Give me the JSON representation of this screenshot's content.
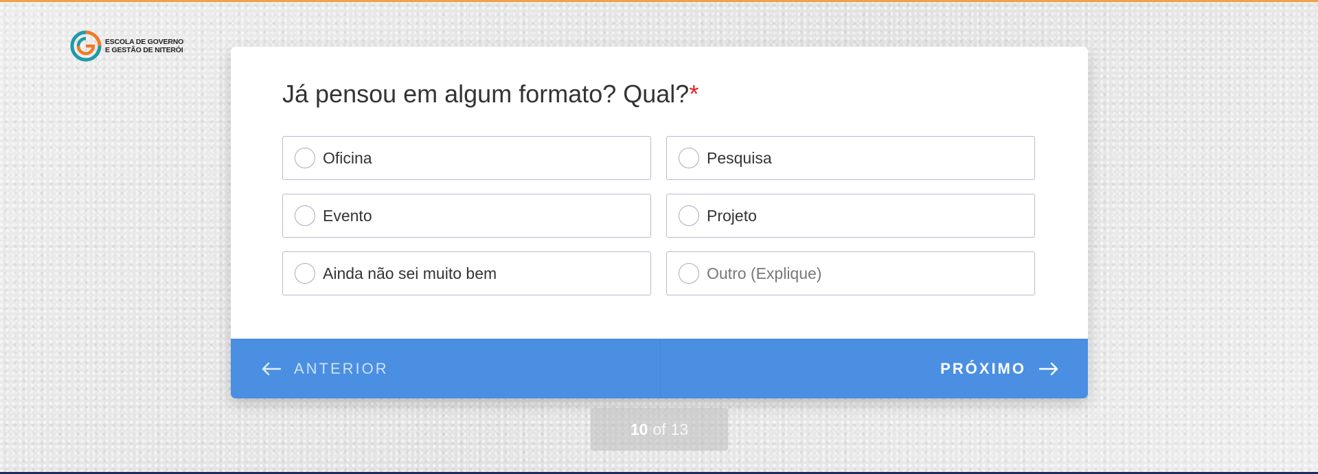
{
  "logo": {
    "line1": "ESCOLA DE GOVERNO",
    "line2": "E GESTÃO DE NITERÓI"
  },
  "question": {
    "text": "Já pensou em algum formato? Qual?",
    "required_mark": "*"
  },
  "options": [
    {
      "label": "Oficina"
    },
    {
      "label": "Pesquisa"
    },
    {
      "label": "Evento"
    },
    {
      "label": "Projeto"
    },
    {
      "label": "Ainda não sei muito bem"
    },
    {
      "label": "Outro (Explique)"
    }
  ],
  "nav": {
    "prev_label": "ANTERIOR",
    "next_label": "PRÓXIMO",
    "prev_icon": "arrow-left-icon",
    "next_icon": "arrow-right-icon"
  },
  "pager": {
    "current": "10",
    "of": "of",
    "total": "13"
  },
  "colors": {
    "accent": "#4a8fe2",
    "required": "#e02424",
    "top_stripe": "#f0a14a",
    "bottom_stripe": "#1f2a5a"
  }
}
